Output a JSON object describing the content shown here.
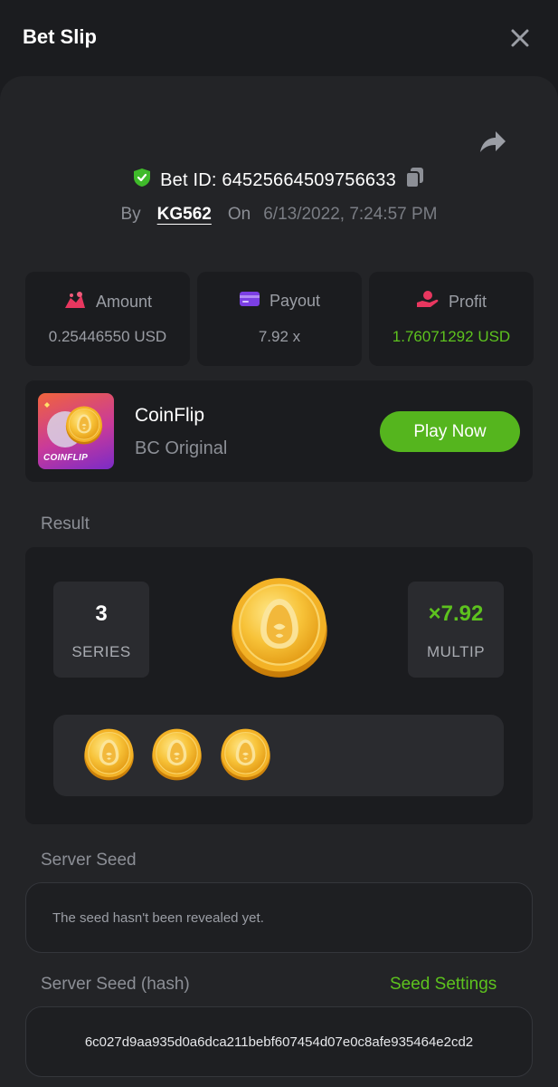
{
  "header": {
    "title": "Bet Slip",
    "close_icon": "close-icon"
  },
  "bet": {
    "id_label": "Bet ID: 64525664509756633",
    "by_label": "By",
    "user": "KG562",
    "on_label": "On",
    "date": "6/13/2022, 7:24:57 PM"
  },
  "stats": {
    "amount": {
      "label": "Amount",
      "value": "0.25446550 USD",
      "icon": "amount-icon"
    },
    "payout": {
      "label": "Payout",
      "value": "7.92 x",
      "icon": "payout-card-icon"
    },
    "profit": {
      "label": "Profit",
      "value": "1.76071292 USD",
      "icon": "profit-hand-icon"
    }
  },
  "game": {
    "name": "CoinFlip",
    "provider": "BC Original",
    "thumb_text": "COINFLIP",
    "play_label": "Play Now"
  },
  "result": {
    "label": "Result",
    "series_value": "3",
    "series_label": "SERIES",
    "multiplier_value": "×7.92",
    "multiplier_label": "MULTIP",
    "history_count": 3
  },
  "server_seed": {
    "label": "Server Seed",
    "value": "The seed hasn't been revealed yet."
  },
  "server_seed_hash": {
    "label": "Server Seed (hash)",
    "settings_label": "Seed Settings",
    "value": "6c027d9aa935d0a6dca211bebf607454d07e0c8afe935464e2cd2"
  },
  "colors": {
    "accent_green": "#5dc21e",
    "button_green": "#55b51e",
    "background": "#1b1c1f",
    "panel": "#232427"
  }
}
